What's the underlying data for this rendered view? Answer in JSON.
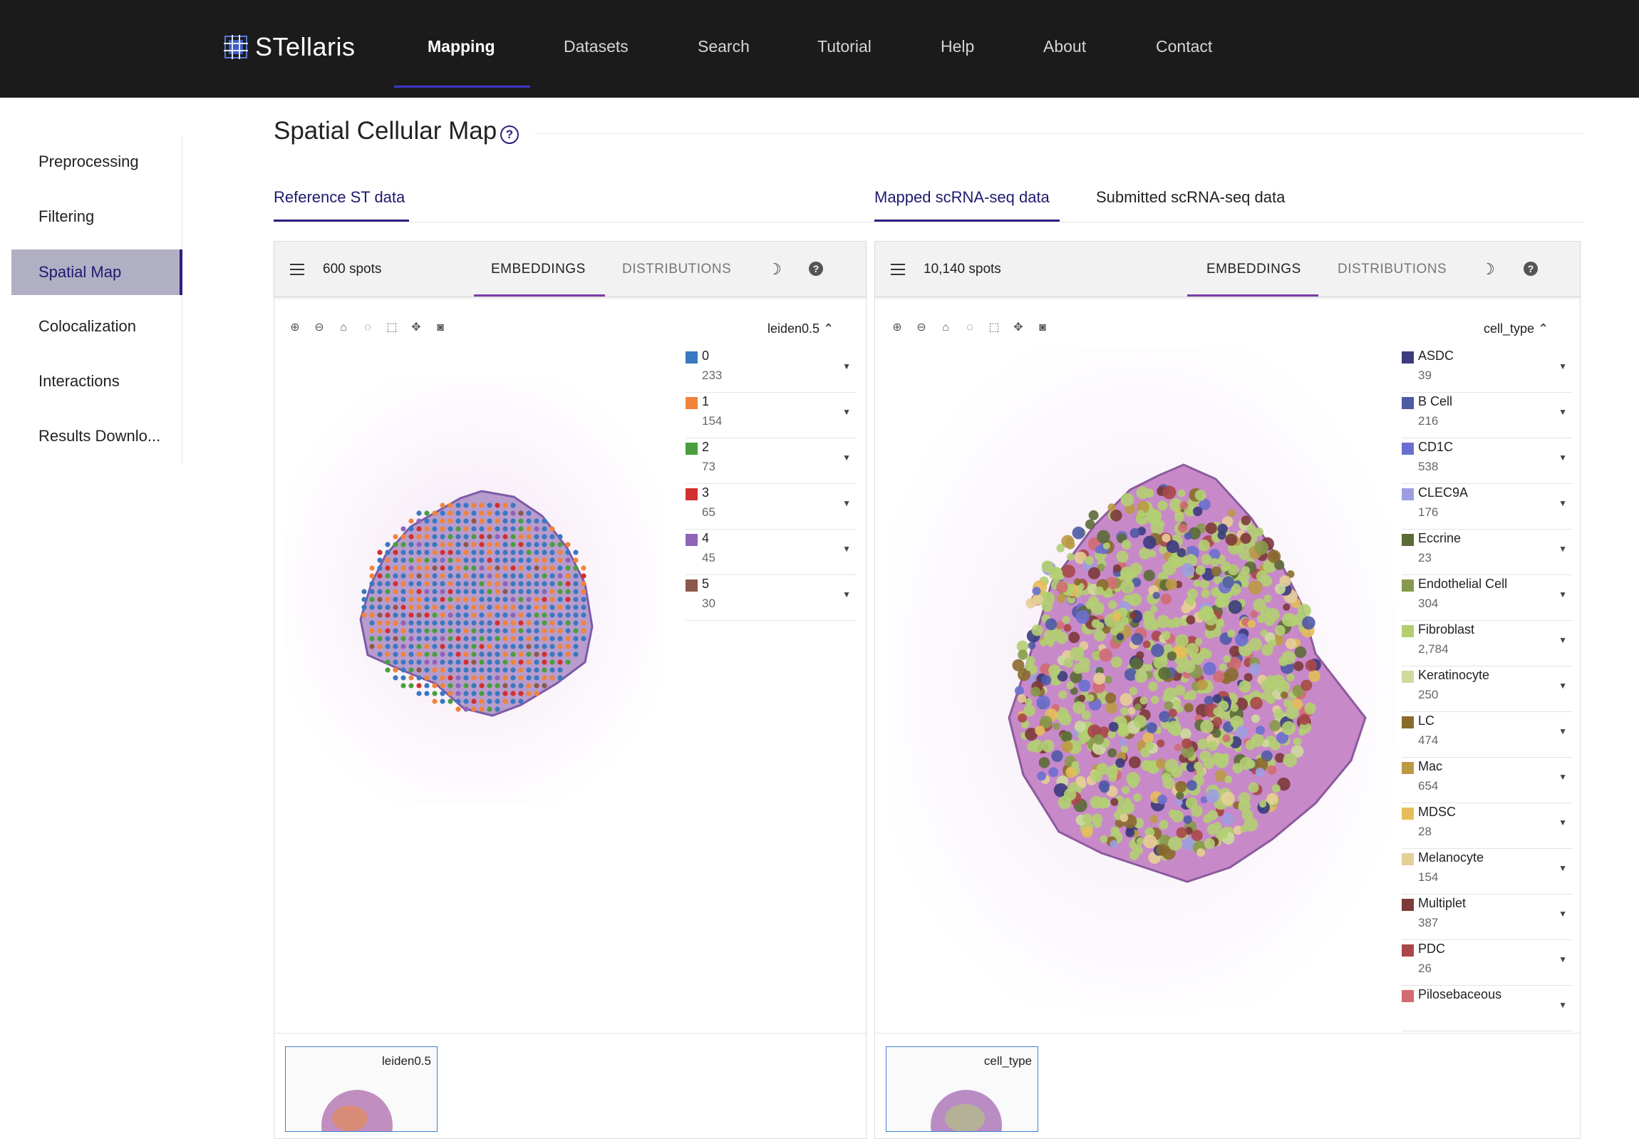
{
  "app": {
    "name": "STellaris"
  },
  "nav": [
    {
      "label": "Mapping",
      "active": true
    },
    {
      "label": "Datasets"
    },
    {
      "label": "Search"
    },
    {
      "label": "Tutorial"
    },
    {
      "label": "Help"
    },
    {
      "label": "About"
    },
    {
      "label": "Contact"
    }
  ],
  "sidebar": {
    "items": [
      {
        "label": "Preprocessing"
      },
      {
        "label": "Filtering"
      },
      {
        "label": "Spatial Map",
        "active": true
      },
      {
        "label": "Colocalization"
      },
      {
        "label": "Interactions"
      },
      {
        "label": "Results Downlo..."
      }
    ]
  },
  "page": {
    "title": "Spatial Cellular Map",
    "help_icon": "?",
    "tabs": {
      "reference": "Reference ST data",
      "mapped": "Mapped scRNA-seq data",
      "submitted": "Submitted scRNA-seq data"
    }
  },
  "left_panel": {
    "spots": "600 spots",
    "tab_embeddings": "EMBEDDINGS",
    "tab_distributions": "DISTRIBUTIONS",
    "color_by": "leiden0.5",
    "thumb_label": "leiden0.5",
    "legend": [
      {
        "label": "0",
        "count": "233",
        "color": "#3a78bf"
      },
      {
        "label": "1",
        "count": "154",
        "color": "#f0843a"
      },
      {
        "label": "2",
        "count": "73",
        "color": "#4a9e3e"
      },
      {
        "label": "3",
        "count": "65",
        "color": "#d2302e"
      },
      {
        "label": "4",
        "count": "45",
        "color": "#8f63b8"
      },
      {
        "label": "5",
        "count": "30",
        "color": "#8b5849"
      }
    ]
  },
  "right_panel": {
    "spots": "10,140 spots",
    "tab_embeddings": "EMBEDDINGS",
    "tab_distributions": "DISTRIBUTIONS",
    "color_by": "cell_type",
    "thumb_label": "cell_type",
    "legend": [
      {
        "label": "ASDC",
        "count": "39",
        "color": "#3b3b7e"
      },
      {
        "label": "B Cell",
        "count": "216",
        "color": "#4f5aa6"
      },
      {
        "label": "CD1C",
        "count": "538",
        "color": "#6a6fcf"
      },
      {
        "label": "CLEC9A",
        "count": "176",
        "color": "#9d9ee0"
      },
      {
        "label": "Eccrine",
        "count": "23",
        "color": "#5b6b36"
      },
      {
        "label": "Endothelial Cell",
        "count": "304",
        "color": "#879a4a"
      },
      {
        "label": "Fibroblast",
        "count": "2,784",
        "color": "#b3cf72"
      },
      {
        "label": "Keratinocyte",
        "count": "250",
        "color": "#cddb9c"
      },
      {
        "label": "LC",
        "count": "474",
        "color": "#8a6b2c"
      },
      {
        "label": "Mac",
        "count": "654",
        "color": "#bb9a45"
      },
      {
        "label": "MDSC",
        "count": "28",
        "color": "#e4be5a"
      },
      {
        "label": "Melanocyte",
        "count": "154",
        "color": "#e6cf96"
      },
      {
        "label": "Multiplet",
        "count": "387",
        "color": "#7c3a38"
      },
      {
        "label": "PDC",
        "count": "26",
        "color": "#a94848"
      },
      {
        "label": "Pilosebaceous",
        "count": "",
        "color": "#d26b72"
      }
    ]
  },
  "icons": [
    "zoom-in-icon",
    "zoom-out-icon",
    "home-icon",
    "lasso-icon",
    "box-select-icon",
    "pan-icon",
    "camera-icon",
    "menu-icon",
    "moon-icon",
    "help-icon",
    "chevron-up-icon",
    "chevron-down-icon"
  ]
}
